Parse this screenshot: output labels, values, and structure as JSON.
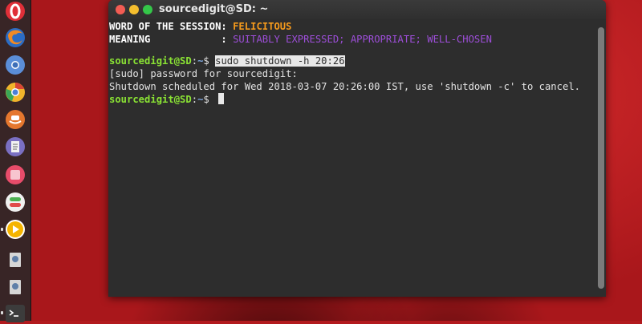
{
  "window": {
    "title": "sourcedigit@SD: ~"
  },
  "terminal": {
    "word_label": "WORD OF THE SESSION: ",
    "word_value": "FELICITOUS",
    "meaning_label": "MEANING            : ",
    "meaning_value": "SUITABLY EXPRESSED; APPROPRIATE; WELL-CHOSEN",
    "prompt_user": "sourcedigit@SD",
    "prompt_sep": ":",
    "prompt_dir": "~",
    "prompt_sym": "$ ",
    "command": "sudo shutdown -h 20:26",
    "sudo_line": "[sudo] password for sourcedigit:",
    "shutdown_line": "Shutdown scheduled for Wed 2018-03-07 20:26:00 IST, use 'shutdown -c' to cancel."
  },
  "launcher": {
    "items": [
      {
        "icon": "opera-icon"
      },
      {
        "icon": "firefox-icon"
      },
      {
        "icon": "chromium-icon"
      },
      {
        "icon": "chrome-icon"
      },
      {
        "icon": "amazon-icon"
      },
      {
        "icon": "text-editor-icon"
      },
      {
        "icon": "app-icon"
      },
      {
        "icon": "settings-toggle-icon"
      },
      {
        "icon": "media-player-icon"
      },
      {
        "icon": "disk-icon"
      },
      {
        "icon": "disk-icon"
      },
      {
        "icon": "terminal-icon"
      }
    ]
  },
  "colors": {
    "wallpaper": "#b21a1e",
    "terminal_bg": "#2d2d2d",
    "prompt_user": "#8ae234",
    "prompt_dir": "#7ea6dc",
    "word_value": "#f59a1c",
    "meaning_value": "#9d4ed8"
  }
}
